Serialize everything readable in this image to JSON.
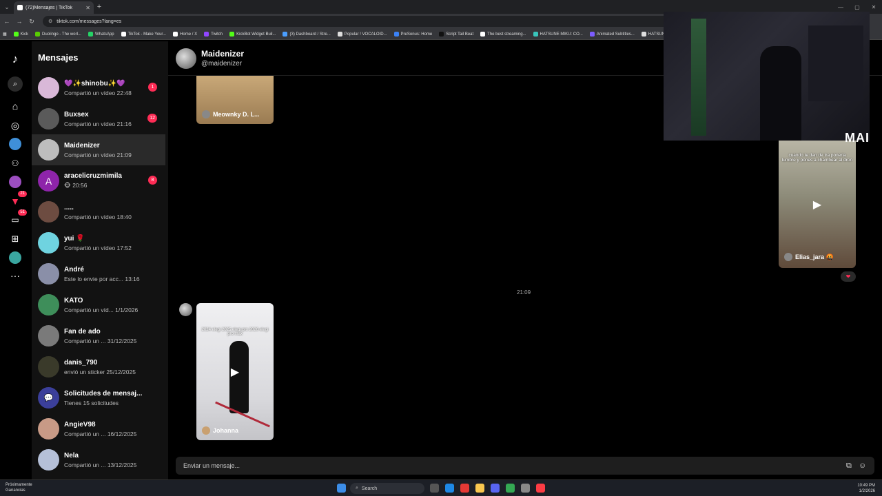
{
  "browser": {
    "tab_title": "(72)Mensajes | TikTok",
    "url": "tiktok.com/messages?lang=es",
    "bookmarks": [
      "Kick",
      "Duolingo - The worl...",
      "WhatsApp",
      "TikTok - Make Your...",
      "Home / X",
      "Twitch",
      "KickBot Widget Buil...",
      "(3) Dashboard / Stre...",
      "Popular ! VOCALOID...",
      "PreSonus: Home",
      "Script Tail Beat",
      "The best streaming...",
      "HATSUNE MIKU: CO...",
      "Animated Subtitles...",
      "HATSUNE M"
    ],
    "bookmark_colors": [
      "#53fc18",
      "#58cc02",
      "#25d366",
      "#ffffff",
      "#ffffff",
      "#9146ff",
      "#53fc18",
      "#4a9eff",
      "#dddddd",
      "#3b82f6",
      "#111111",
      "#ffffff",
      "#39c5bb",
      "#7c5cff",
      "#dddddd"
    ]
  },
  "rail": {
    "icons": [
      "tiktok-logo-icon",
      "search-icon",
      "home-icon",
      "explore-icon",
      "following-icon",
      "friends-icon",
      "live-icon",
      "activity-icon",
      "messages-icon",
      "upload-icon",
      "profile-icon",
      "more-icon"
    ],
    "activity_badge": "21",
    "messages_badge": "51"
  },
  "conversations": {
    "title": "Mensajes",
    "items": [
      {
        "name": "💜✨shinobu✨💜",
        "sub": "Compartió un vídeo 22:48",
        "badge": "1",
        "color": "#d9b8d8"
      },
      {
        "name": "Buxsex",
        "sub": "Compartió un vídeo 21:16",
        "badge": "12",
        "color": "#5a5a5a"
      },
      {
        "name": "Maidenizer",
        "sub": "Compartió un vídeo 21:09",
        "badge": "",
        "color": "#bdbdbd"
      },
      {
        "name": "aracelicruzmimila",
        "sub": "🐵 20:56",
        "badge": "8",
        "color": "#8e24aa",
        "initial": "A"
      },
      {
        "name": ".....",
        "sub": "Compartió un vídeo 18:40",
        "badge": "",
        "color": "#6d4c41"
      },
      {
        "name": "yui 🌹",
        "sub": "Compartió un vídeo 17:52",
        "badge": "",
        "color": "#6fd3e0"
      },
      {
        "name": "André",
        "sub": "Este lo envie por acc... 13:16",
        "badge": "",
        "color": "#8a8fa8"
      },
      {
        "name": "KATO",
        "sub": "Compartió un víd... 1/1/2026",
        "badge": "",
        "color": "#3e8e5a"
      },
      {
        "name": "Fan de ado",
        "sub": "Compartió un ... 31/12/2025",
        "badge": "",
        "color": "#7a7a7a"
      },
      {
        "name": "danis_790",
        "sub": "envió un sticker 25/12/2025",
        "badge": "",
        "color": "#3a3a2a"
      },
      {
        "name": "Solicitudes de mensaj...",
        "sub": "Tienes 15 solicitudes",
        "badge": "",
        "color": "#3b3f9a"
      },
      {
        "name": "AngieV98",
        "sub": "Compartió un ... 16/12/2025",
        "badge": "",
        "color": "#c89a86"
      },
      {
        "name": "Nela",
        "sub": "Compartió un ... 13/12/2025",
        "badge": "",
        "color": "#b5c0d8"
      }
    ]
  },
  "chat": {
    "header_name": "Maidenizer",
    "header_handle": "@maidenizer",
    "timestamp": "21:09",
    "videos": [
      {
        "user": "Meownky D. L...",
        "caption": ""
      },
      {
        "user": "Elias_jara 🤬",
        "caption": "cuando te dan de tra ponerla lumbre y pones a chambear al dron"
      },
      {
        "user": "Johanna",
        "caption": "2024 elegi 2025 elegi pro 2026 elegi pro max"
      }
    ],
    "composer_placeholder": "Enviar un mensaje..."
  },
  "overlay": {
    "watermark": "MAI"
  },
  "taskbar": {
    "weather_title": "Próximamente",
    "weather_sub": "Ganancias",
    "search": "Search",
    "time": "10:49 PM",
    "date": "1/2/2026"
  }
}
